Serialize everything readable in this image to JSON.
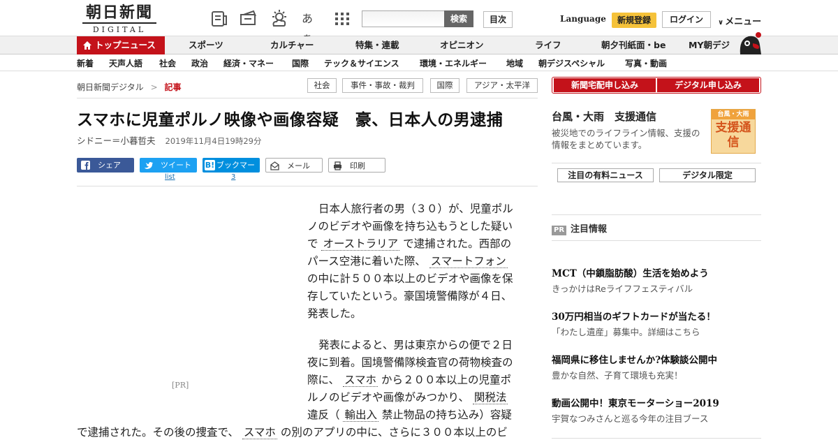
{
  "header": {
    "logo_jp": "朝日新聞",
    "logo_en": "DIGITAL",
    "font_toggle": "あぁ",
    "search_button": "検索",
    "toc_button": "目次",
    "language": "Language",
    "register": "新規登録",
    "login": "ログイン",
    "menu": "メニュー"
  },
  "nav_primary": [
    "トップニュース",
    "スポーツ",
    "カルチャー",
    "特集・連載",
    "オピニオン",
    "ライフ",
    "朝夕刊紙面・be",
    "MY朝デジ"
  ],
  "nav_secondary": [
    "新着",
    "天声人語",
    "社会",
    "政治",
    "経済・マネー",
    "国際",
    "テック＆サイエンス",
    "環境・エネルギー",
    "地域",
    "朝デジスペシャル",
    "写真・動画"
  ],
  "breadcrumb": {
    "home": "朝日新聞デジタル",
    "sep": ">",
    "current": "記事"
  },
  "tags": [
    "社会",
    "事件・事故・裁判",
    "国際",
    "アジア・太平洋"
  ],
  "article": {
    "title": "スマホに児童ポルノ映像や画像容疑　豪、日本人の男逮捕",
    "author": "シドニー＝小暮哲夫",
    "date": "2019年11月4日19時29分",
    "share": {
      "facebook": "シェア",
      "twitter": "ツイート",
      "twitter_count": "list",
      "hatena": "ブックマーク",
      "hatena_count": "3",
      "mail": "メール",
      "print": "印刷"
    },
    "pr_label": "[PR]",
    "p1": {
      "l1": "日本人旅行者の男（３０）が、児童ポル",
      "l2": "ノのビデオや画像を持ち込もうとした疑い",
      "l3a": "で",
      "l3kw": "オーストラリア",
      "l3b": "で逮捕された。西部の",
      "l4a": "パース空港に着いた際、",
      "l4kw": "スマートフォン",
      "l5": "の中に計５００本以上のビデオや画像を保",
      "l6": "存していたという。豪国境警備隊が４日、",
      "l7": "発表した。"
    },
    "p2": {
      "l1": "発表によると、男は東京からの便で２日",
      "l2": "夜に到着。国境警備隊検査官の荷物検査の",
      "l3a": "際に、",
      "l3kw": "スマホ",
      "l3b": "から２００本以上の児童ポ",
      "l4a": "ルノのビデオや画像がみつかり、",
      "l4kw": "関税法",
      "l5a": "違反（",
      "l5kw": "輸出入",
      "l5b": "禁止物品の持ち込み）容疑",
      "l6a": "で逮捕された。その後の捜査で、",
      "l6kw": "スマホ",
      "l6b": "の別のアプリの中に、さらに３００本以上のビ"
    }
  },
  "sidebar": {
    "subscribe_paper": "新聞宅配申し込み",
    "subscribe_digital": "デジタル申し込み",
    "typhoon_title": "台風・大雨　支援通信",
    "typhoon_desc": "被災地でのライフライン情報、支援の情報をまとめています。",
    "typhoon_badge_top": "台風・大雨",
    "typhoon_badge_main": "支援通信",
    "btn_paid_news": "注目の有料ニュース",
    "btn_digital_only": "デジタル限定",
    "pr_badge": "PR",
    "pr_heading": "注目情報",
    "pr_items": [
      {
        "title": "MCT（中鎖脂肪酸）生活を始めよう",
        "sub": "きっかけはReライフフェスティバル"
      },
      {
        "title": "30万円相当のギフトカードが当たる！",
        "sub": "「わたし遺産」募集中。詳細はこちら"
      },
      {
        "title": "福岡県に移住しませんか?体験談公開中",
        "sub": "豊かな自然、子育て環境も充実！"
      },
      {
        "title": "動画公開中！東京モーターショー2019",
        "sub": "宇賀なつみさんと巡る今年の注目ブース"
      }
    ]
  },
  "colors": {
    "brand_red": "#c4121a",
    "register_yellow": "#f5c23a",
    "facebook": "#3b5998",
    "twitter": "#1da1f2",
    "hatena": "#008fde"
  }
}
